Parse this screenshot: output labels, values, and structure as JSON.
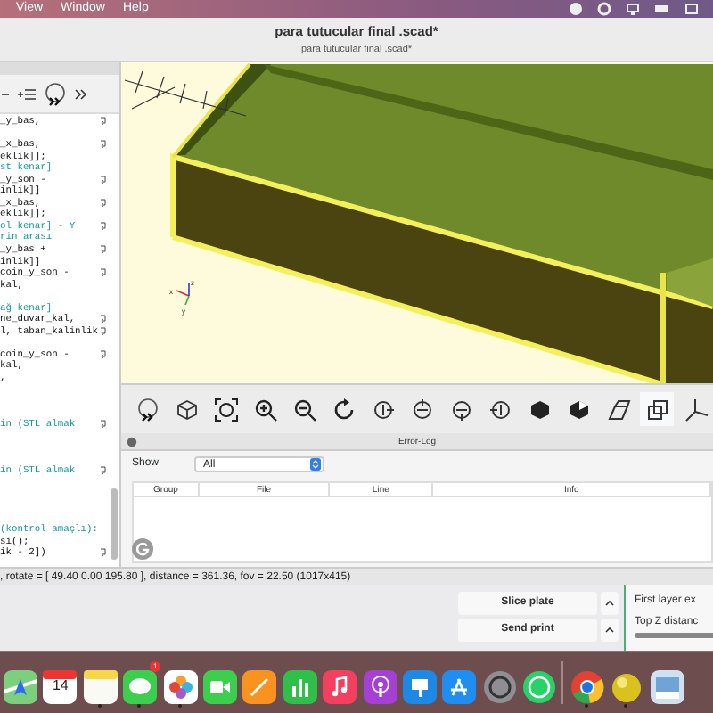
{
  "menu_bar": {
    "items": [
      "View",
      "Window",
      "Help"
    ]
  },
  "window": {
    "title": "para tutucular final .scad*",
    "tab": "para tutucular final .scad*"
  },
  "editor": {
    "lines": [
      {
        "kind": "code",
        "text": "_y_bas,",
        "wrapped": true
      },
      {
        "kind": "blank"
      },
      {
        "kind": "code",
        "text": "_x_bas,",
        "wrapped": true
      },
      {
        "kind": "code",
        "text": "eklik]];",
        "wrapped": false
      },
      {
        "kind": "comment",
        "text": "st kenar]",
        "wrapped": false
      },
      {
        "kind": "code",
        "text": "_y_son -",
        "wrapped": true
      },
      {
        "kind": "code",
        "text": "inlik]]",
        "wrapped": false
      },
      {
        "kind": "code",
        "text": "_x_bas,",
        "wrapped": true
      },
      {
        "kind": "code",
        "text": "eklik]];",
        "wrapped": false
      },
      {
        "kind": "comment",
        "text": "ol kenar] - Y",
        "wrapped": true
      },
      {
        "kind": "comment",
        "text": "rin arası",
        "wrapped": false
      },
      {
        "kind": "code",
        "text": "_y_bas +",
        "wrapped": true
      },
      {
        "kind": "code",
        "text": "inlik]]",
        "wrapped": false
      },
      {
        "kind": "code",
        "text": "coin_y_son -",
        "wrapped": true
      },
      {
        "kind": "code",
        "text": "kal,",
        "wrapped": false
      },
      {
        "kind": "blank"
      },
      {
        "kind": "comment",
        "text": "ağ kenar]",
        "wrapped": false
      },
      {
        "kind": "code",
        "text": "ne_duvar_kal,",
        "wrapped": true
      },
      {
        "kind": "code",
        "text": "l, taban_kalinlik",
        "wrapped": true
      },
      {
        "kind": "blank"
      },
      {
        "kind": "code",
        "text": "coin_y_son -",
        "wrapped": true
      },
      {
        "kind": "code",
        "text": "kal,",
        "wrapped": false
      },
      {
        "kind": "code",
        "text": ",",
        "wrapped": false
      },
      {
        "kind": "blank"
      },
      {
        "kind": "blank"
      },
      {
        "kind": "blank"
      },
      {
        "kind": "comment",
        "text": "in (STL almak",
        "wrapped": true
      },
      {
        "kind": "blank"
      },
      {
        "kind": "blank"
      },
      {
        "kind": "blank"
      },
      {
        "kind": "comment",
        "text": "in (STL almak",
        "wrapped": true
      },
      {
        "kind": "blank"
      },
      {
        "kind": "blank"
      },
      {
        "kind": "blank"
      },
      {
        "kind": "blank"
      },
      {
        "kind": "comment",
        "text": "(kontrol amaçlı):",
        "wrapped": false
      },
      {
        "kind": "code",
        "text": "si();",
        "wrapped": false
      },
      {
        "kind": "code",
        "text": "ik - 2])",
        "wrapped": true
      }
    ]
  },
  "viewport": {
    "axis_labels": [
      "x",
      "y",
      "z"
    ]
  },
  "view_toolbar": [
    {
      "kind": "render"
    },
    {
      "kind": "preview"
    },
    {
      "kind": "view-all"
    },
    {
      "kind": "zoom-in"
    },
    {
      "kind": "zoom-out"
    },
    {
      "kind": "reset"
    },
    {
      "kind": "right"
    },
    {
      "kind": "top"
    },
    {
      "kind": "bottom"
    },
    {
      "kind": "left"
    },
    {
      "kind": "front"
    },
    {
      "kind": "back"
    },
    {
      "kind": "perspective"
    },
    {
      "kind": "ortho"
    },
    {
      "kind": "axes"
    }
  ],
  "error_log": {
    "title": "Error-Log",
    "show_label": "Show",
    "filter": "All",
    "columns": [
      "Group",
      "File",
      "Line",
      "Info"
    ]
  },
  "status_bar": ", rotate = [ 49.40 0.00 195.80 ], distance = 361.36, fov = 22.50 (1017x415)",
  "slicer": {
    "buttons": [
      "Slice plate",
      "Send print"
    ],
    "settings": [
      "First layer ex",
      "Top Z distanc"
    ]
  },
  "dock": {
    "apps": [
      {
        "kind": "maps",
        "running": false
      },
      {
        "kind": "calendar",
        "text": "14",
        "running": false
      },
      {
        "kind": "notes",
        "running": true
      },
      {
        "kind": "messages",
        "badge": "1",
        "running": true
      },
      {
        "kind": "photos",
        "running": true
      },
      {
        "kind": "facetime",
        "running": false
      },
      {
        "kind": "pages",
        "running": false
      },
      {
        "kind": "numbers",
        "running": false
      },
      {
        "kind": "music",
        "running": false
      },
      {
        "kind": "podcasts",
        "running": false
      },
      {
        "kind": "keynote",
        "running": false
      },
      {
        "kind": "appstore",
        "running": false
      },
      {
        "kind": "settings",
        "running": false
      },
      {
        "kind": "whatsapp",
        "running": false
      },
      {
        "kind": "divider"
      },
      {
        "kind": "chrome",
        "running": true
      },
      {
        "kind": "ball",
        "running": true
      },
      {
        "kind": "preview",
        "running": false
      }
    ]
  }
}
